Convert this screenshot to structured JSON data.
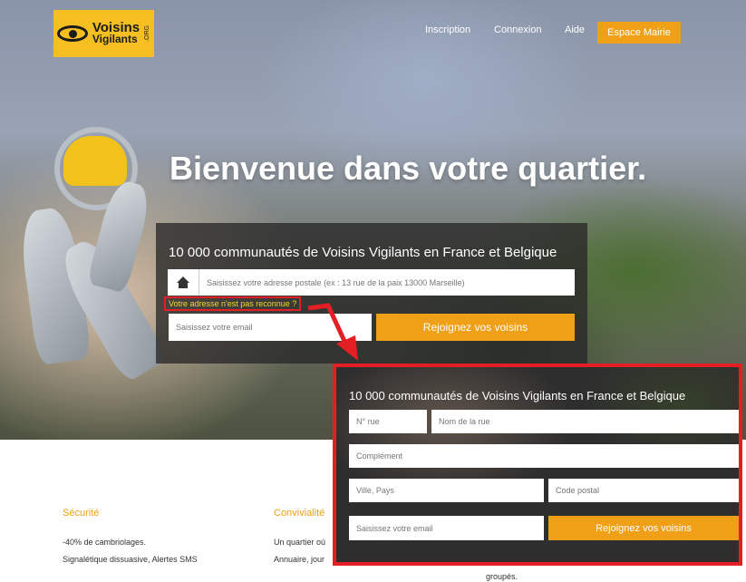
{
  "nav": {
    "logo_line1": "Voisins",
    "logo_line2": "Vigilants",
    "logo_org": ".ORG",
    "inscription": "Inscription",
    "connexion": "Connexion",
    "aide": "Aide",
    "espace_mairie": "Espace Mairie"
  },
  "hero": {
    "title": "Bienvenue dans votre quartier."
  },
  "signup_form": {
    "heading": "10 000 communautés de Voisins Vigilants en France et Belgique",
    "address_placeholder": "Saisissez votre adresse postale (ex : 13 rue de la paix 13000 Marseille)",
    "address_not_found": "Votre adresse n'est pas reconnue ?",
    "email_placeholder": "Saisissez votre email",
    "join_label": "Rejoignez vos voisins"
  },
  "detailed_form": {
    "heading": "10 000 communautés de Voisins Vigilants en France et Belgique",
    "street_number_placeholder": "N° rue",
    "street_name_placeholder": "Nom de la rue",
    "complement_placeholder": "Complément",
    "city_country_placeholder": "Ville, Pays",
    "postal_code_placeholder": "Code postal",
    "email_placeholder": "Saisissez votre email",
    "join_label": "Rejoignez vos voisins"
  },
  "features": {
    "security": {
      "title": "Sécurité",
      "line1": "-40% de cambriolages.",
      "line2": "Signalétique dissuasive, Alertes SMS"
    },
    "conviviality": {
      "title": "Convivialité",
      "line1": "Un quartier où",
      "line2": "Annuaire, jour",
      "line3": "groupés."
    }
  },
  "colors": {
    "accent": "#f0a016",
    "logo_bg": "#f5bf22",
    "highlight_red": "#e31e24",
    "warning_text": "#f5d72b"
  }
}
